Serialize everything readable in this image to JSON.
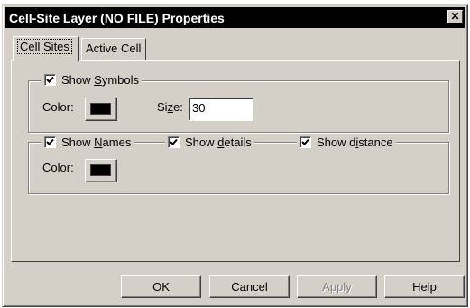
{
  "window": {
    "title": "Cell-Site Layer (NO FILE) Properties",
    "close_glyph": "✕"
  },
  "tabs": [
    {
      "label": "Cell Sites",
      "active": true
    },
    {
      "label": "Active Cell",
      "active": false
    }
  ],
  "symbols_group": {
    "checkbox": {
      "pre": "Show ",
      "mnemonic": "S",
      "post": "ymbols",
      "checked": true
    },
    "color_label": "Color:",
    "color_value": "#000000",
    "size_label_pre": "Si",
    "size_label_mnemonic": "z",
    "size_label_post": "e:",
    "size_value": "30"
  },
  "names_group": {
    "show_names": {
      "pre": "Show ",
      "mnemonic": "N",
      "post": "ames",
      "checked": true
    },
    "show_details": {
      "pre": "Show ",
      "mnemonic": "d",
      "post": "etails",
      "checked": true
    },
    "show_distance": {
      "pre": "Show d",
      "mnemonic": "i",
      "post": "stance",
      "checked": true
    },
    "color_label": "Color:",
    "color_value": "#000000"
  },
  "buttons": {
    "ok": "OK",
    "cancel": "Cancel",
    "apply": "Apply",
    "help": "Help"
  }
}
